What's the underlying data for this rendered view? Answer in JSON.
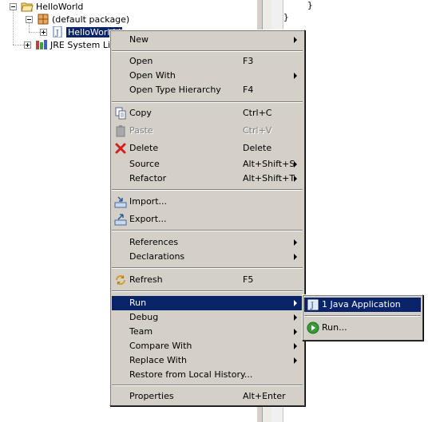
{
  "explorer": {
    "project": "HelloWorld",
    "package": "(default package)",
    "file": "HelloWorld.j",
    "library": "JRE System Lib"
  },
  "editor": {
    "lines": [
      "}",
      "}"
    ]
  },
  "context_menu": {
    "new": {
      "label": "New"
    },
    "open": {
      "label": "Open",
      "accel": "F3"
    },
    "open_with": {
      "label": "Open With"
    },
    "open_type_hierarchy": {
      "label": "Open Type Hierarchy",
      "accel": "F4"
    },
    "copy": {
      "label": "Copy",
      "accel": "Ctrl+C"
    },
    "paste": {
      "label": "Paste",
      "accel": "Ctrl+V"
    },
    "delete": {
      "label": "Delete",
      "accel": "Delete"
    },
    "source": {
      "label": "Source",
      "accel": "Alt+Shift+S"
    },
    "refactor": {
      "label": "Refactor",
      "accel": "Alt+Shift+T"
    },
    "import": {
      "label": "Import..."
    },
    "export": {
      "label": "Export..."
    },
    "references": {
      "label": "References"
    },
    "declarations": {
      "label": "Declarations"
    },
    "refresh": {
      "label": "Refresh",
      "accel": "F5"
    },
    "run": {
      "label": "Run"
    },
    "debug": {
      "label": "Debug"
    },
    "team": {
      "label": "Team"
    },
    "compare_with": {
      "label": "Compare With"
    },
    "replace_with": {
      "label": "Replace With"
    },
    "restore": {
      "label": "Restore from Local History..."
    },
    "properties": {
      "label": "Properties",
      "accel": "Alt+Enter"
    }
  },
  "run_submenu": {
    "java_app": {
      "label": "1 Java Application"
    },
    "run_dialog": {
      "label": "Run..."
    }
  },
  "colors": {
    "menu_bg": "#d4d0c8",
    "selection": "#0a246a"
  }
}
